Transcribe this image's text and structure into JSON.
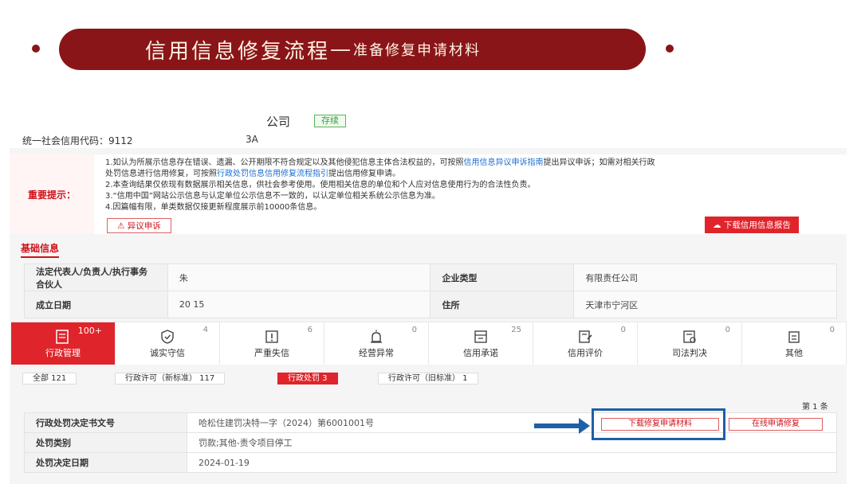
{
  "banner": {
    "main": "信用信息修复流程",
    "dash": "—",
    "sub": "准备修复申请材料"
  },
  "company": {
    "name": "公司",
    "status": "存续",
    "credit_code_label": "统一社会信用代码：9112",
    "credit_code_tail": "3A"
  },
  "notice": {
    "label": "重要提示：",
    "line1_a": "1.如认为所展示信息存在错误、遗漏、公开期限不符合规定以及其他侵犯信息主体合法权益的，可按照",
    "line1_link": "信用信息异议申诉指南",
    "line1_b": "提出异议申诉；如需对相关行政",
    "line1_c": "处罚信息进行信用修复，可按照",
    "line1_link2": "行政处罚信息信用修复流程指引",
    "line1_d": "提出信用修复申请。",
    "line2": "2.本查询结果仅依现有数据展示相关信息，供社会参考使用。使用相关信息的单位和个人应对信息使用行为的合法性负责。",
    "line3": "3.“信用中国”网站公示信息与认定单位公示信息不一致的，以认定单位相关系统公示信息为准。",
    "line4": "4.因篇幅有限，单类数据仅接更新程度展示前10000条信息。",
    "dispute_button": "异议申诉",
    "report_button": "下载信用信息报告"
  },
  "basic": {
    "title": "基础信息",
    "rows": [
      {
        "k1": "法定代表人/负责人/执行事务合伙人",
        "v1": "朱",
        "k2": "企业类型",
        "v2": "有限责任公司"
      },
      {
        "k1": "成立日期",
        "v1": "20          15",
        "k2": "住所",
        "v2": "天津市宁河区"
      }
    ]
  },
  "tabs": [
    {
      "label": "行政管理",
      "count": "100+",
      "icon": "document-icon"
    },
    {
      "label": "诚实守信",
      "count": "4",
      "icon": "shield-check-icon"
    },
    {
      "label": "严重失信",
      "count": "6",
      "icon": "warning-icon"
    },
    {
      "label": "经营异常",
      "count": "0",
      "icon": "alarm-icon"
    },
    {
      "label": "信用承诺",
      "count": "25",
      "icon": "commitment-icon"
    },
    {
      "label": "信用评价",
      "count": "0",
      "icon": "evaluation-icon"
    },
    {
      "label": "司法判决",
      "count": "0",
      "icon": "judgment-icon"
    },
    {
      "label": "其他",
      "count": "0",
      "icon": "other-icon"
    }
  ],
  "subtabs": [
    {
      "label": "全部  121"
    },
    {
      "label": "行政许可（新标准）  117"
    },
    {
      "label": "行政处罚  3"
    },
    {
      "label": "行政许可（旧标准）  1"
    }
  ],
  "page_label": "第 1 条",
  "detail": [
    {
      "k": "行政处罚决定书文号",
      "v": "哈松住建罚决特一字（2024）第6001001号"
    },
    {
      "k": "处罚类别",
      "v": "罚款;其他-责令项目停工"
    },
    {
      "k": "处罚决定日期",
      "v": "2024-01-19"
    }
  ],
  "actions": {
    "download_repair": "下载修复申请材料",
    "online_repair": "在线申请修复"
  },
  "colors": {
    "banner": "#8a1518",
    "accent": "#e0242b",
    "highlight": "#1f5fa8"
  }
}
